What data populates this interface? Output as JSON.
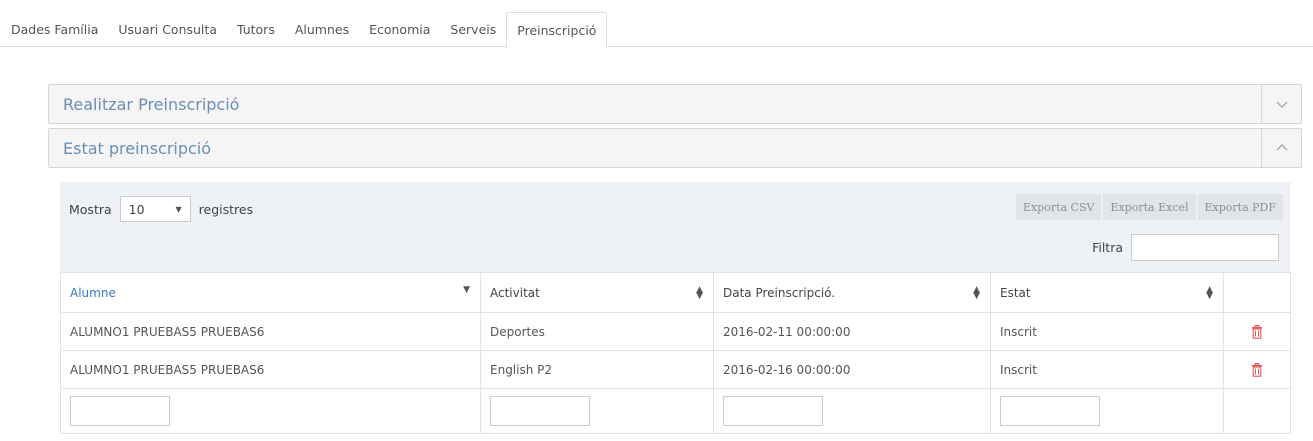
{
  "tabs": [
    {
      "label": "Dades Família",
      "active": false
    },
    {
      "label": "Usuari Consulta",
      "active": false
    },
    {
      "label": "Tutors",
      "active": false
    },
    {
      "label": "Alumnes",
      "active": false
    },
    {
      "label": "Economia",
      "active": false
    },
    {
      "label": "Serveis",
      "active": false
    },
    {
      "label": "Preinscripció",
      "active": true
    }
  ],
  "panels": {
    "realitzar": {
      "title": "Realitzar Preinscripció",
      "toggle_icon": "chevron-down-icon"
    },
    "estat": {
      "title": "Estat preinscripció",
      "toggle_icon": "chevron-up-icon"
    }
  },
  "toolbar": {
    "show_label": "Mostra",
    "page_size": "10",
    "records_label": "registres",
    "export_csv": "Exporta CSV",
    "export_excel": "Exporta Excel",
    "export_pdf": "Exporta PDF",
    "filter_label": "Filtra",
    "filter_value": ""
  },
  "table": {
    "columns": [
      "Alumne",
      "Activitat",
      "Data Preinscripció.",
      "Estat"
    ],
    "rows": [
      [
        "ALUMNO1 PRUEBAS5 PRUEBAS6",
        "Deportes",
        "2016-02-11 00:00:00",
        "Inscrit"
      ],
      [
        "ALUMNO1 PRUEBAS5 PRUEBAS6",
        "English P2",
        "2016-02-16 00:00:00",
        "Inscrit"
      ]
    ],
    "delete_icon": "trash-icon"
  },
  "colors": {
    "link": "#6a8fb3",
    "sorted_header": "#3b78c4",
    "delete": "#e05a5a",
    "toolbar_bg": "#eef1f5"
  }
}
